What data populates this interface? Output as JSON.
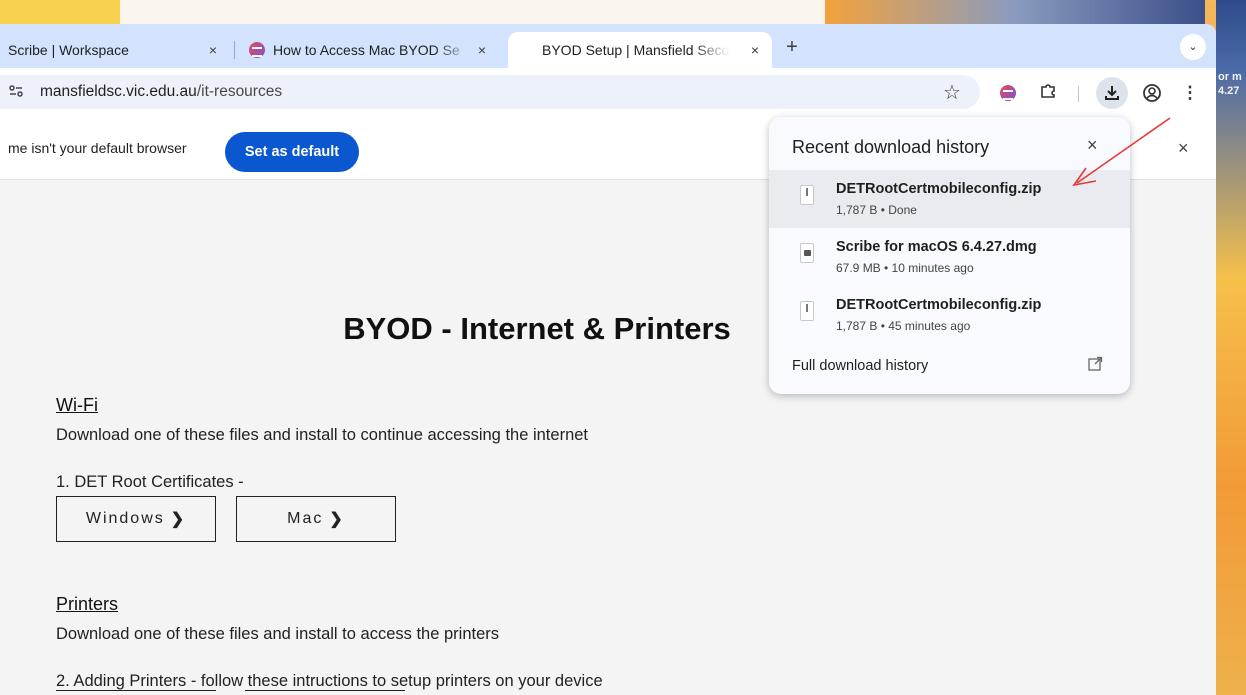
{
  "desktop": {
    "peek_text_1": "or m",
    "peek_text_2": "4.27"
  },
  "tabs": [
    {
      "title": "Scribe | Workspace",
      "close": "×"
    },
    {
      "title": "How to Access Mac BYOD Se",
      "close": "×"
    },
    {
      "title": "BYOD Setup | Mansfield Seco",
      "close": "×"
    }
  ],
  "new_tab": "+",
  "tab_search": "⌄",
  "toolbar": {
    "site_info_icon": "tune-icon",
    "url_host": "mansfieldsc.vic.edu.au",
    "url_path": "/it-resources",
    "bookmark": "☆",
    "puzzle": "⧉",
    "download": "⤓",
    "profile": "◉",
    "menu": "⋮"
  },
  "infobar": {
    "text": "me isn't your default browser",
    "button": "Set as default",
    "close": "×"
  },
  "page": {
    "title": "BYOD - Internet & Printers",
    "wifi_heading": "Wi-Fi",
    "wifi_text": "Download one of these files and install to continue accessing the internet",
    "step1": "1. DET Root Certificates -",
    "windows_btn": "Windows",
    "mac_btn": "Mac",
    "chevron": "❯",
    "printers_heading": "Printers",
    "printers_text": "Download one of these files and install to access the printers",
    "step2": "2. Adding Printers - follow these intructions to setup printers on your device"
  },
  "downloads": {
    "title": "Recent download history",
    "close": "×",
    "items": [
      {
        "name": "DETRootCertmobileconfig.zip",
        "meta": "1,787 B • Done"
      },
      {
        "name": "Scribe for macOS 6.4.27.dmg",
        "meta": "67.9 MB • 10 minutes ago"
      },
      {
        "name": "DETRootCertmobileconfig.zip",
        "meta": "1,787 B • 45 minutes ago"
      }
    ],
    "full_history": "Full download history",
    "open_icon": "↗"
  },
  "colors": {
    "accent": "#0b57d0",
    "annotation": "#e53935",
    "tabstrip": "#d3e3fd"
  }
}
